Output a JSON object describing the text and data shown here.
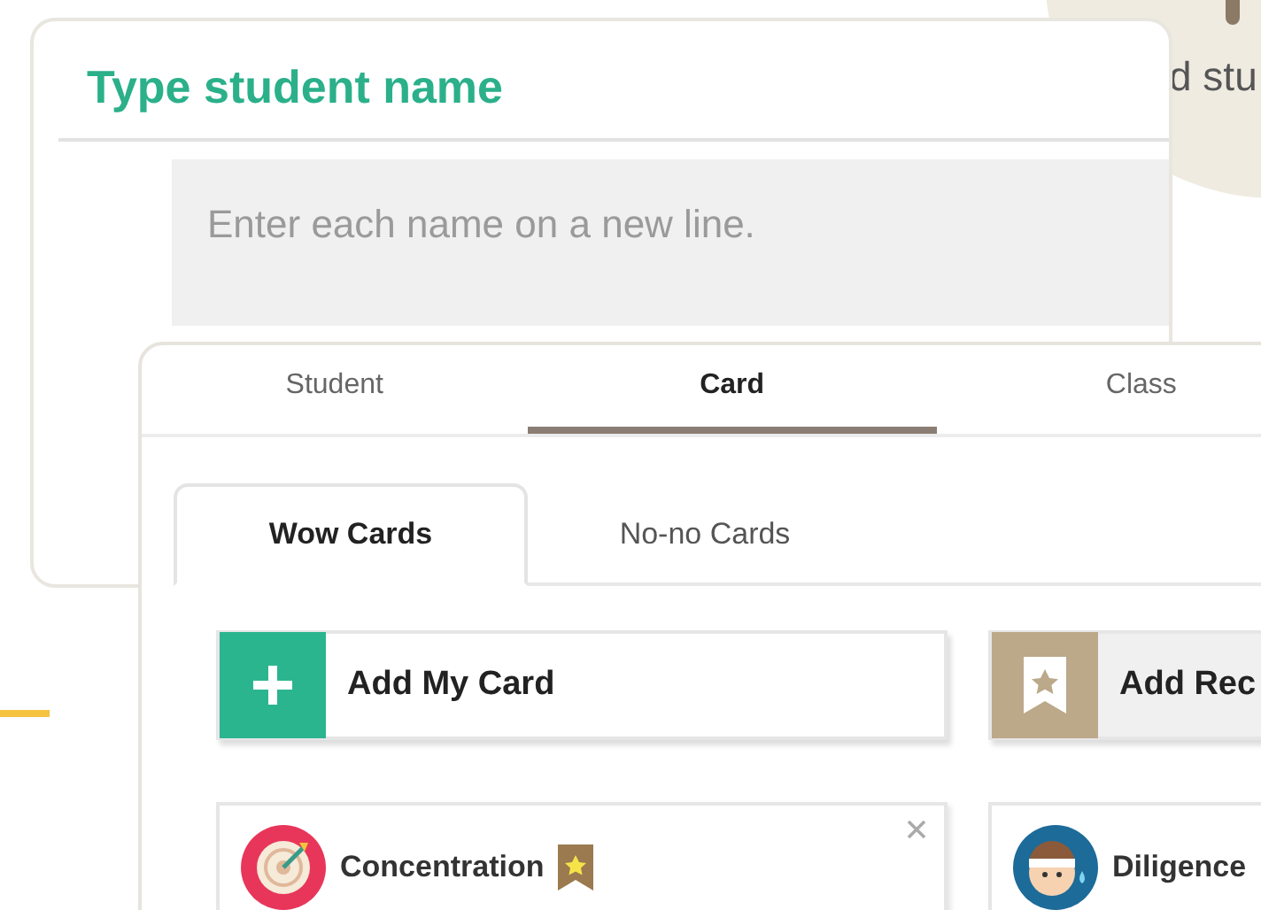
{
  "background_badge": {
    "text": "d stu"
  },
  "name_dialog": {
    "title": "Type student name",
    "names_field": {
      "placeholder": "Enter each name on a new line."
    }
  },
  "card_panel": {
    "tabs": [
      {
        "label": "Student",
        "selected": false
      },
      {
        "label": "Card",
        "selected": true
      },
      {
        "label": "Class",
        "selected": false
      }
    ],
    "subtabs": [
      {
        "label": "Wow Cards",
        "selected": true
      },
      {
        "label": "No-no Cards",
        "selected": false
      }
    ],
    "actions": [
      {
        "kind": "add",
        "label": "Add My Card"
      },
      {
        "kind": "recommend",
        "label": "Add Rec"
      }
    ],
    "cards": [
      {
        "kind": "target",
        "label": "Concentration",
        "bookmarked": true,
        "removable": true
      },
      {
        "kind": "face",
        "label": "Diligence"
      }
    ]
  }
}
